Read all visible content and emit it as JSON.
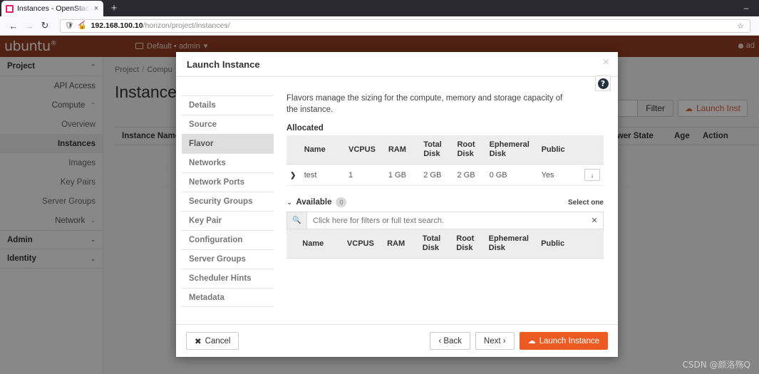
{
  "browser": {
    "tab": {
      "title": "Instances - OpenStack Da",
      "close": "×",
      "favicon": "openstack-favicon"
    },
    "new_tab": "+",
    "window_minimize": "–",
    "back": "←",
    "forward": "→",
    "reload": "↻",
    "url_host": "192.168.100.10",
    "url_path": "/horizon/project/instances/",
    "bookmark_star": "☆"
  },
  "topbar": {
    "brand": "ubuntu",
    "brand_sup": "®",
    "context": "Default • admin",
    "context_caret": "▾",
    "user": "ad"
  },
  "sidebar": {
    "groups": [
      {
        "label": "Project",
        "caret": "⌃"
      },
      {
        "label": "Admin",
        "caret": "⌄"
      },
      {
        "label": "Identity",
        "caret": "⌄"
      }
    ],
    "items": [
      {
        "label": "API Access",
        "caret": ""
      },
      {
        "label": "Compute",
        "caret": "⌃"
      },
      {
        "label": "Overview",
        "caret": ""
      },
      {
        "label": "Instances",
        "caret": ""
      },
      {
        "label": "Images",
        "caret": ""
      },
      {
        "label": "Key Pairs",
        "caret": ""
      },
      {
        "label": "Server Groups",
        "caret": ""
      },
      {
        "label": "Network",
        "caret": "⌄"
      }
    ]
  },
  "page": {
    "breadcrumb_project": "Project",
    "breadcrumb_sep": "/",
    "breadcrumb_compute": "Compu",
    "title": "Instances",
    "filter_button": "Filter",
    "launch_button": "Launch Inst",
    "launch_icon": "cloud-icon",
    "table_headers": [
      "Instance Name",
      "Power State",
      "Age",
      "Action"
    ]
  },
  "modal": {
    "title": "Launch Instance",
    "close": "×",
    "help_icon": "question-mark-icon",
    "help_glyph": "?",
    "steps": [
      "Details",
      "Source",
      "Flavor",
      "Networks",
      "Network Ports",
      "Security Groups",
      "Key Pair",
      "Configuration",
      "Server Groups",
      "Scheduler Hints",
      "Metadata"
    ],
    "active_step": "Flavor",
    "description": "Flavors manage the sizing for the compute, memory and storage capacity of the instance.",
    "allocated_label": "Allocated",
    "table_headers": [
      "Name",
      "VCPUS",
      "RAM",
      "Total Disk",
      "Root Disk",
      "Ephemeral Disk",
      "Public"
    ],
    "allocated_rows": [
      {
        "expand": "❯",
        "name": "test",
        "vcpus": "1",
        "ram": "1 GB",
        "total_disk": "2 GB",
        "root_disk": "2 GB",
        "ephemeral_disk": "0 GB",
        "public": "Yes",
        "action": "↓"
      }
    ],
    "available_caret": "⌄",
    "available_label": "Available",
    "available_count": "0",
    "select_one": "Select one",
    "filter_placeholder": "Click here for filters or full text search.",
    "filter_value": "",
    "filter_icon": "search-icon",
    "filter_clear": "✕",
    "buttons": {
      "cancel": "Cancel",
      "cancel_icon": "✖",
      "back": "‹ Back",
      "next": "Next ›",
      "launch": "Launch Instance",
      "launch_icon": "cloud-icon"
    }
  },
  "watermark": "CSDN @颜洛殇Q",
  "colors": {
    "ubuntu_header": "#943c23",
    "accent_orange": "#ed5b23",
    "link_orange": "#e0613a"
  }
}
